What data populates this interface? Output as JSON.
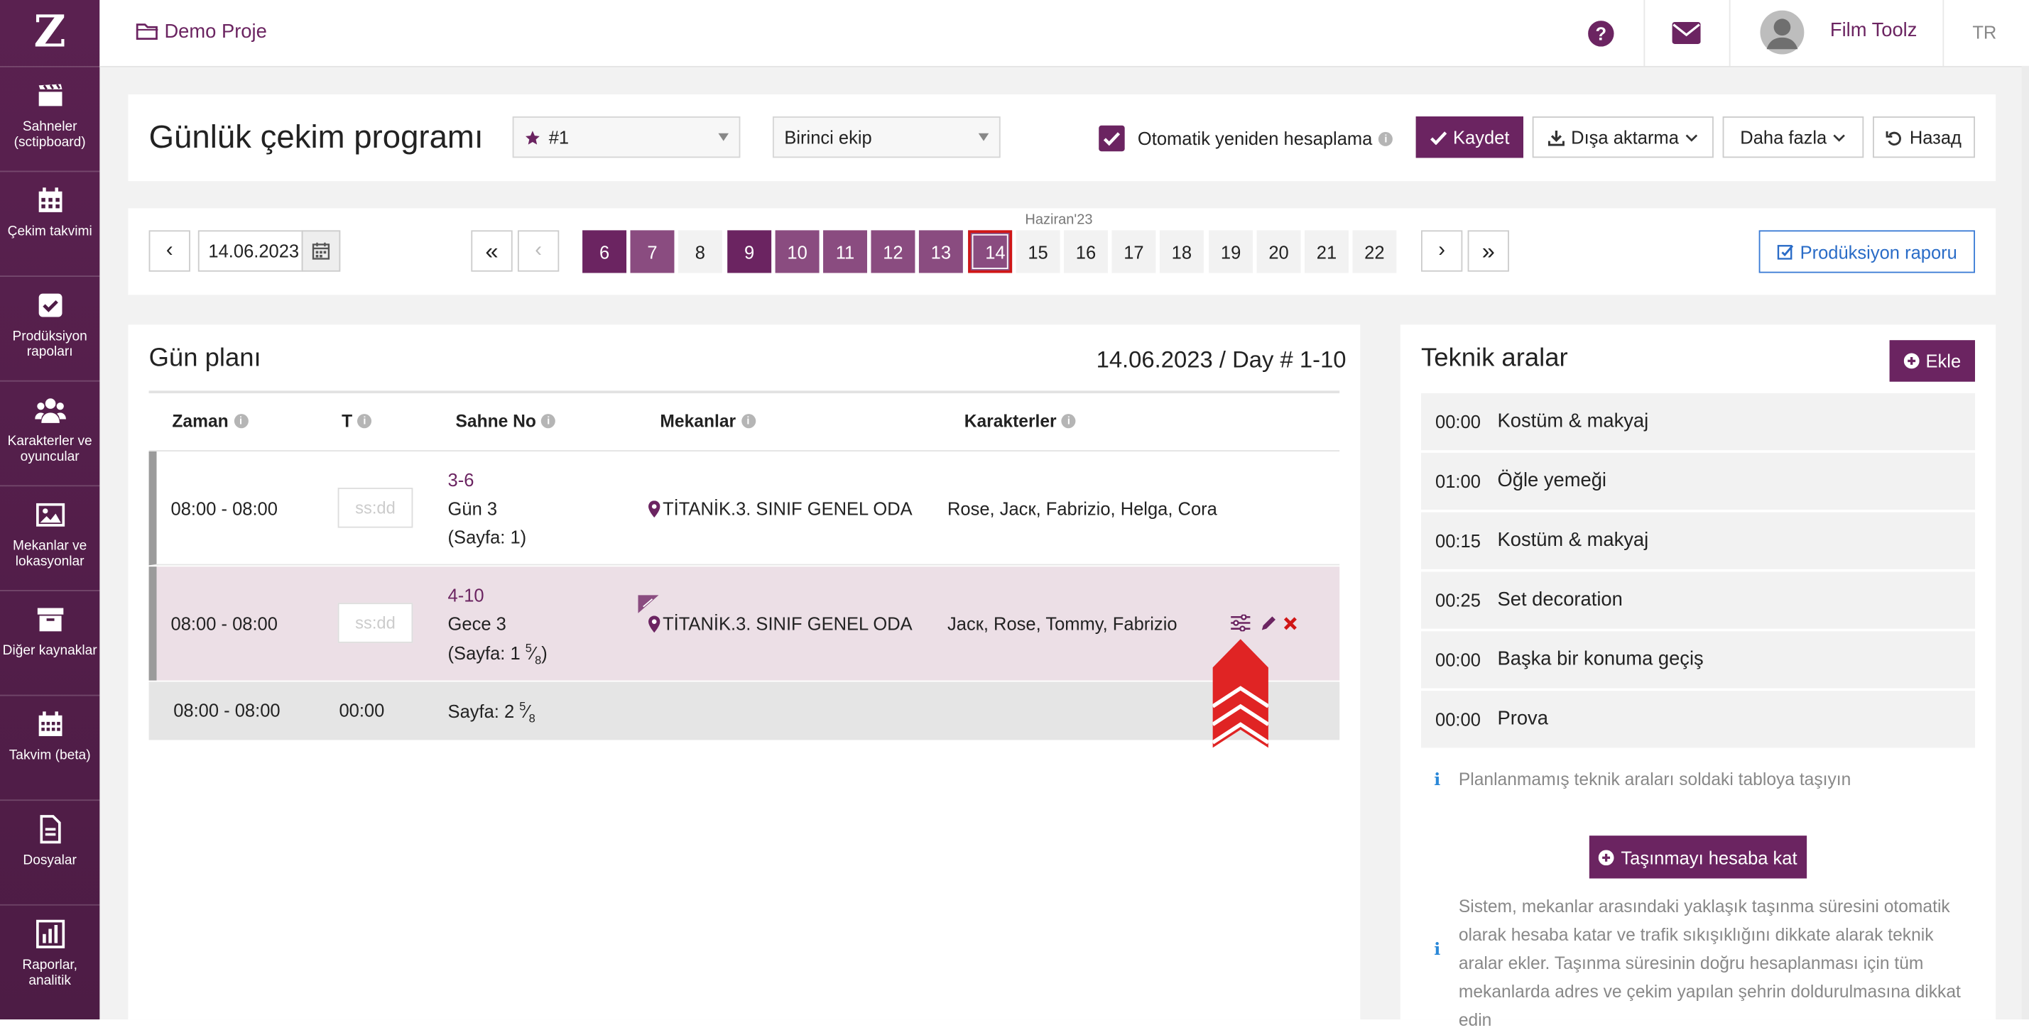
{
  "sidebar": {
    "logo": "Z",
    "items": [
      {
        "label": "Sahneler (sctipboard)",
        "icon": "clapperboard-icon"
      },
      {
        "label": "Çekim takvimi",
        "icon": "calendar-icon"
      },
      {
        "label": "Prodüksiyon rapoları",
        "icon": "checkbox-icon"
      },
      {
        "label": "Karakterler ve oyuncular",
        "icon": "users-icon"
      },
      {
        "label": "Mekanlar ve lokasyonlar",
        "icon": "image-icon"
      },
      {
        "label": "Diğer kaynaklar",
        "icon": "archive-icon"
      },
      {
        "label": "Takvim (beta)",
        "icon": "calendar-grid-icon"
      },
      {
        "label": "Dosyalar",
        "icon": "file-icon"
      },
      {
        "label": "Raporlar, analitik",
        "icon": "bar-chart-icon"
      }
    ]
  },
  "topbar": {
    "project": "Demo Proje",
    "user": "Film Toolz",
    "lang": "TR"
  },
  "header": {
    "title": "Günlük çekim programı",
    "unit_select": "#1",
    "team_select": "Birinci ekip",
    "auto_recalc_label": "Otomatik yeniden hesaplama",
    "auto_recalc_checked": true,
    "save": "Kaydet",
    "export": "Dışa aktarma",
    "more": "Daha fazla",
    "back": "Назад"
  },
  "dates": {
    "current": "14.06.2023",
    "month_label": "Haziran'23",
    "days": [
      {
        "n": "6",
        "state": "dark"
      },
      {
        "n": "7",
        "state": "mid"
      },
      {
        "n": "8",
        "state": "plain"
      },
      {
        "n": "9",
        "state": "dark"
      },
      {
        "n": "10",
        "state": "mid"
      },
      {
        "n": "11",
        "state": "mid"
      },
      {
        "n": "12",
        "state": "mid"
      },
      {
        "n": "13",
        "state": "mid"
      },
      {
        "n": "14",
        "state": "sel"
      },
      {
        "n": "15",
        "state": "plain"
      },
      {
        "n": "16",
        "state": "plain"
      },
      {
        "n": "17",
        "state": "plain"
      },
      {
        "n": "18",
        "state": "plain"
      },
      {
        "n": "19",
        "state": "plain"
      },
      {
        "n": "20",
        "state": "plain"
      },
      {
        "n": "21",
        "state": "plain"
      },
      {
        "n": "22",
        "state": "plain"
      }
    ],
    "report_button": "Prodüksiyon raporu"
  },
  "day_plan": {
    "title": "Gün planı",
    "summary": "14.06.2023 / Day # 1-10",
    "columns": {
      "time": "Zaman",
      "t": "T",
      "scene_no": "Sahne No",
      "locations": "Mekanlar",
      "characters": "Karakterler"
    },
    "rows": [
      {
        "time": "08:00 - 08:00",
        "t_placeholder": "ss:dd",
        "scene": "3-6",
        "daynight": "Gün 3",
        "page_prefix": "(Sayfa: 1)",
        "location": "TİTANİK.3. SINIF GENEL ODA",
        "characters": "Rose, Jacк, Fabrizio, Helga, Cora"
      },
      {
        "time": "08:00 - 08:00",
        "t_placeholder": "ss:dd",
        "scene": "4-10",
        "daynight": "Gece 3",
        "page_prefix": "(Sayfa: 1",
        "page_num": "5",
        "page_den": "8",
        "page_suffix": ")",
        "location": "TİTANİK.3. SINIF GENEL ODA",
        "characters": "Jacк, Rose, Tommy, Fabrizio"
      }
    ],
    "total": {
      "time": "08:00 - 08:00",
      "t": "00:00",
      "pages_prefix": "Sayfa: 2",
      "pages_num": "5",
      "pages_den": "8"
    }
  },
  "technical": {
    "title": "Teknik aralar",
    "add": "Ekle",
    "items": [
      {
        "time": "00:00",
        "name": "Kostüm & makyaj"
      },
      {
        "time": "01:00",
        "name": "Öğle yemeği"
      },
      {
        "time": "00:15",
        "name": "Kostüm & makyaj"
      },
      {
        "time": "00:25",
        "name": "Set decoration"
      },
      {
        "time": "00:00",
        "name": "Başka bir konuma geçiş"
      },
      {
        "time": "00:00",
        "name": "Prova"
      }
    ],
    "hint": "Planlanmamış teknik araları soldaki tabloya taşıyın",
    "transfer_button": "Taşınmayı hesaba kat",
    "description": "Sistem, mekanlar arasındaki yaklaşık taşınma süresini otomatik olarak hesaba katar ve trafik sıkışıklığını dikkate alarak teknik aralar ekler. Taşınma süresinin doğru hesaplanması için tüm mekanlarda adres ve çekim yapılan şehrin doldurulmasına dikkat edin"
  },
  "colors": {
    "brand": "#6b2461",
    "brand_light": "#8a4c80",
    "selected_border": "#d01616",
    "row_highlight": "#ecdfe6",
    "arrow": "#e02424"
  }
}
